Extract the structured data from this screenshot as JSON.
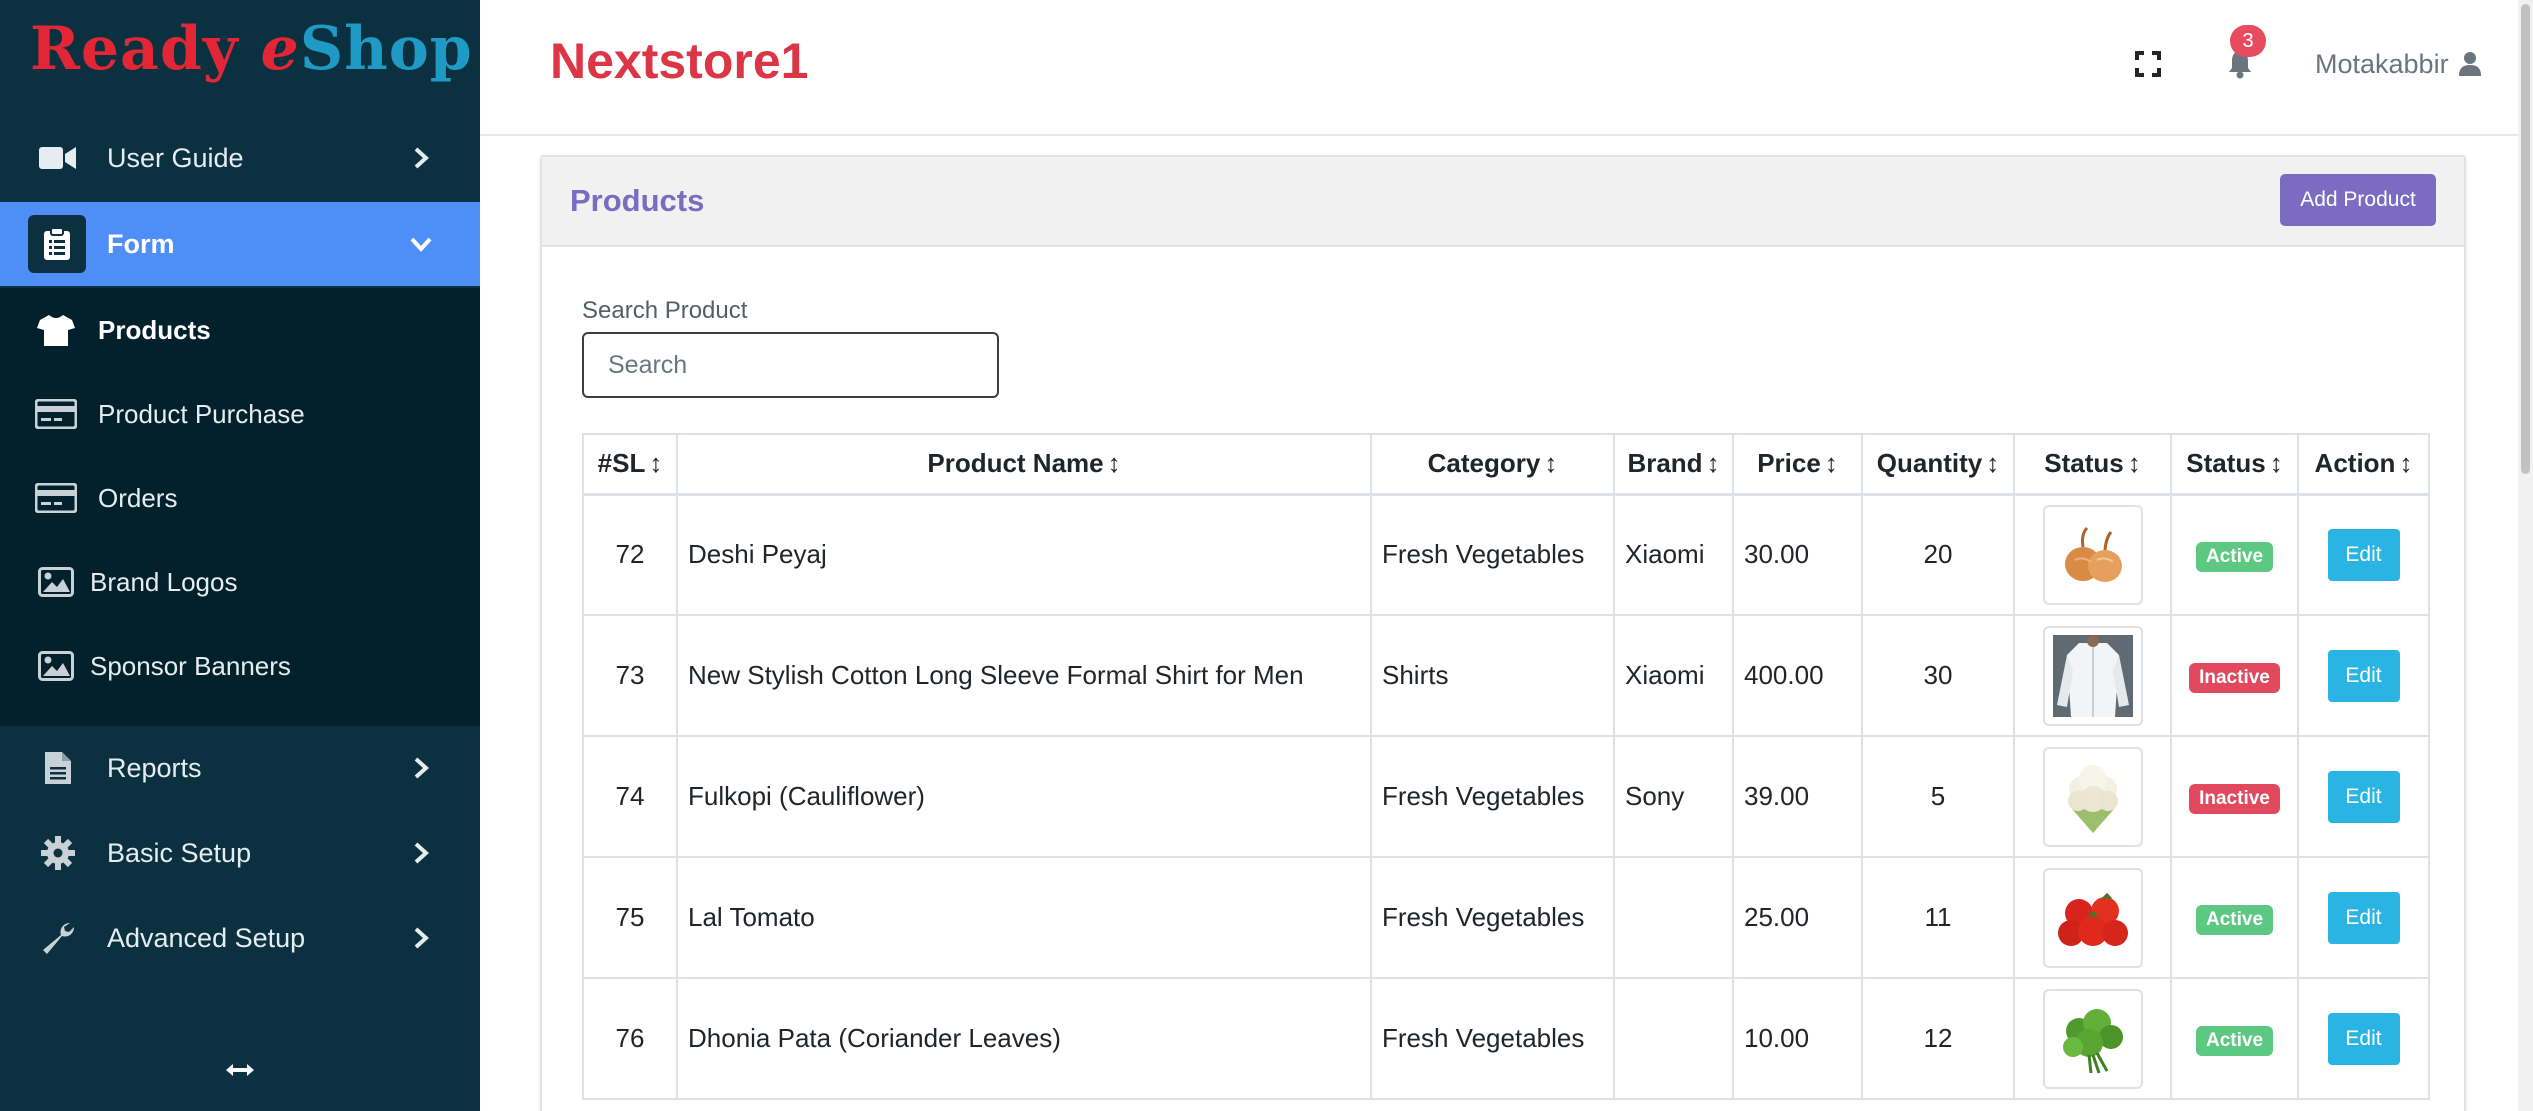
{
  "logo": {
    "part1": "Ready",
    "part2": "e",
    "part3": "Shop"
  },
  "sidebar": {
    "items": [
      {
        "label": "User Guide",
        "icon": "video-camera-icon"
      },
      {
        "label": "Form",
        "icon": "clipboard-icon"
      },
      {
        "label": "Reports",
        "icon": "file-icon"
      },
      {
        "label": "Basic Setup",
        "icon": "gear-icon"
      },
      {
        "label": "Advanced Setup",
        "icon": "wrench-icon"
      }
    ],
    "submenu": [
      {
        "label": "Products",
        "icon": "tshirt-icon"
      },
      {
        "label": "Product Purchase",
        "icon": "credit-card-icon"
      },
      {
        "label": "Orders",
        "icon": "credit-card-icon"
      },
      {
        "label": "Brand Logos",
        "icon": "image-icon"
      },
      {
        "label": "Sponsor Banners",
        "icon": "image-icon"
      }
    ],
    "resize_icon": "horizontal-arrows-icon"
  },
  "header": {
    "store_name": "Nextstore1",
    "notification_count": "3",
    "user_name": "Motakabbir"
  },
  "card": {
    "title": "Products",
    "add_button": "Add Product",
    "search_label": "Search Product",
    "search_placeholder": "Search",
    "search_value": ""
  },
  "table": {
    "headers": [
      "#SL",
      "Product Name",
      "Category",
      "Brand",
      "Price",
      "Quantity",
      "Status",
      "Status",
      "Action"
    ],
    "sort_glyph": "↕",
    "rows": [
      {
        "sl": "72",
        "name": "Deshi Peyaj",
        "category": "Fresh Vegetables",
        "brand": "Xiaomi",
        "price": "30.00",
        "quantity": "20",
        "image": "onion-image",
        "status": "Active",
        "action": "Edit"
      },
      {
        "sl": "73",
        "name": "New Stylish Cotton Long Sleeve Formal Shirt for Men",
        "category": "Shirts",
        "brand": "Xiaomi",
        "price": "400.00",
        "quantity": "30",
        "image": "shirt-image",
        "status": "Inactive",
        "action": "Edit"
      },
      {
        "sl": "74",
        "name": "Fulkopi (Cauliflower)",
        "category": "Fresh Vegetables",
        "brand": "Sony",
        "price": "39.00",
        "quantity": "5",
        "image": "cauliflower-image",
        "status": "Inactive",
        "action": "Edit"
      },
      {
        "sl": "75",
        "name": "Lal Tomato",
        "category": "Fresh Vegetables",
        "brand": "",
        "price": "25.00",
        "quantity": "11",
        "image": "tomato-image",
        "status": "Active",
        "action": "Edit"
      },
      {
        "sl": "76",
        "name": "Dhonia Pata (Coriander Leaves)",
        "category": "Fresh Vegetables",
        "brand": "",
        "price": "10.00",
        "quantity": "12",
        "image": "coriander-image",
        "status": "Active",
        "action": "Edit"
      }
    ]
  },
  "colors": {
    "sidebar_bg": "#0b3140",
    "submenu_bg": "#03212c",
    "active_nav": "#4f8ef7",
    "brand_red": "#dc3545",
    "accent_purple": "#7b6bc1",
    "edit_blue": "#2ab4e3",
    "active_green": "#5cc882",
    "inactive_red": "#e0495e"
  }
}
